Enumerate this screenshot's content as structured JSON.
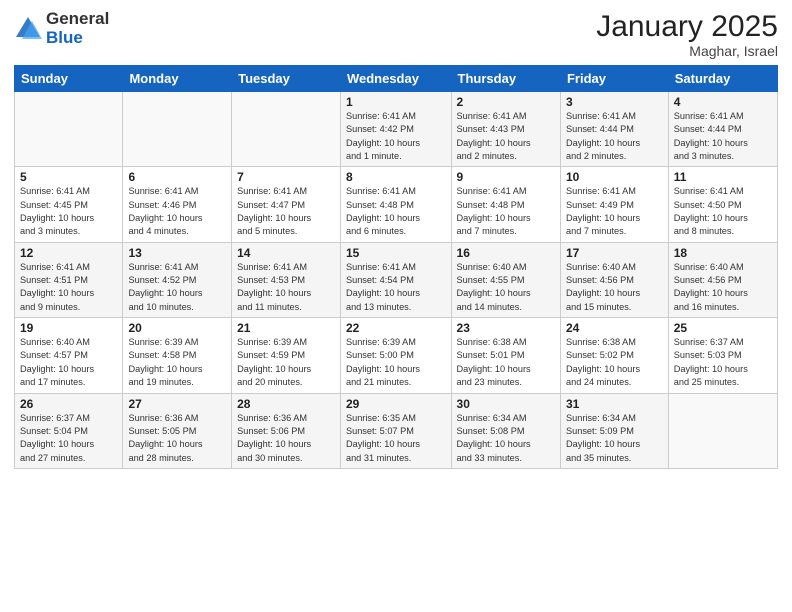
{
  "logo": {
    "general": "General",
    "blue": "Blue"
  },
  "header": {
    "title": "January 2025",
    "subtitle": "Maghar, Israel"
  },
  "weekdays": [
    "Sunday",
    "Monday",
    "Tuesday",
    "Wednesday",
    "Thursday",
    "Friday",
    "Saturday"
  ],
  "weeks": [
    [
      {
        "day": "",
        "info": ""
      },
      {
        "day": "",
        "info": ""
      },
      {
        "day": "",
        "info": ""
      },
      {
        "day": "1",
        "info": "Sunrise: 6:41 AM\nSunset: 4:42 PM\nDaylight: 10 hours\nand 1 minute."
      },
      {
        "day": "2",
        "info": "Sunrise: 6:41 AM\nSunset: 4:43 PM\nDaylight: 10 hours\nand 2 minutes."
      },
      {
        "day": "3",
        "info": "Sunrise: 6:41 AM\nSunset: 4:44 PM\nDaylight: 10 hours\nand 2 minutes."
      },
      {
        "day": "4",
        "info": "Sunrise: 6:41 AM\nSunset: 4:44 PM\nDaylight: 10 hours\nand 3 minutes."
      }
    ],
    [
      {
        "day": "5",
        "info": "Sunrise: 6:41 AM\nSunset: 4:45 PM\nDaylight: 10 hours\nand 3 minutes."
      },
      {
        "day": "6",
        "info": "Sunrise: 6:41 AM\nSunset: 4:46 PM\nDaylight: 10 hours\nand 4 minutes."
      },
      {
        "day": "7",
        "info": "Sunrise: 6:41 AM\nSunset: 4:47 PM\nDaylight: 10 hours\nand 5 minutes."
      },
      {
        "day": "8",
        "info": "Sunrise: 6:41 AM\nSunset: 4:48 PM\nDaylight: 10 hours\nand 6 minutes."
      },
      {
        "day": "9",
        "info": "Sunrise: 6:41 AM\nSunset: 4:48 PM\nDaylight: 10 hours\nand 7 minutes."
      },
      {
        "day": "10",
        "info": "Sunrise: 6:41 AM\nSunset: 4:49 PM\nDaylight: 10 hours\nand 7 minutes."
      },
      {
        "day": "11",
        "info": "Sunrise: 6:41 AM\nSunset: 4:50 PM\nDaylight: 10 hours\nand 8 minutes."
      }
    ],
    [
      {
        "day": "12",
        "info": "Sunrise: 6:41 AM\nSunset: 4:51 PM\nDaylight: 10 hours\nand 9 minutes."
      },
      {
        "day": "13",
        "info": "Sunrise: 6:41 AM\nSunset: 4:52 PM\nDaylight: 10 hours\nand 10 minutes."
      },
      {
        "day": "14",
        "info": "Sunrise: 6:41 AM\nSunset: 4:53 PM\nDaylight: 10 hours\nand 11 minutes."
      },
      {
        "day": "15",
        "info": "Sunrise: 6:41 AM\nSunset: 4:54 PM\nDaylight: 10 hours\nand 13 minutes."
      },
      {
        "day": "16",
        "info": "Sunrise: 6:40 AM\nSunset: 4:55 PM\nDaylight: 10 hours\nand 14 minutes."
      },
      {
        "day": "17",
        "info": "Sunrise: 6:40 AM\nSunset: 4:56 PM\nDaylight: 10 hours\nand 15 minutes."
      },
      {
        "day": "18",
        "info": "Sunrise: 6:40 AM\nSunset: 4:56 PM\nDaylight: 10 hours\nand 16 minutes."
      }
    ],
    [
      {
        "day": "19",
        "info": "Sunrise: 6:40 AM\nSunset: 4:57 PM\nDaylight: 10 hours\nand 17 minutes."
      },
      {
        "day": "20",
        "info": "Sunrise: 6:39 AM\nSunset: 4:58 PM\nDaylight: 10 hours\nand 19 minutes."
      },
      {
        "day": "21",
        "info": "Sunrise: 6:39 AM\nSunset: 4:59 PM\nDaylight: 10 hours\nand 20 minutes."
      },
      {
        "day": "22",
        "info": "Sunrise: 6:39 AM\nSunset: 5:00 PM\nDaylight: 10 hours\nand 21 minutes."
      },
      {
        "day": "23",
        "info": "Sunrise: 6:38 AM\nSunset: 5:01 PM\nDaylight: 10 hours\nand 23 minutes."
      },
      {
        "day": "24",
        "info": "Sunrise: 6:38 AM\nSunset: 5:02 PM\nDaylight: 10 hours\nand 24 minutes."
      },
      {
        "day": "25",
        "info": "Sunrise: 6:37 AM\nSunset: 5:03 PM\nDaylight: 10 hours\nand 25 minutes."
      }
    ],
    [
      {
        "day": "26",
        "info": "Sunrise: 6:37 AM\nSunset: 5:04 PM\nDaylight: 10 hours\nand 27 minutes."
      },
      {
        "day": "27",
        "info": "Sunrise: 6:36 AM\nSunset: 5:05 PM\nDaylight: 10 hours\nand 28 minutes."
      },
      {
        "day": "28",
        "info": "Sunrise: 6:36 AM\nSunset: 5:06 PM\nDaylight: 10 hours\nand 30 minutes."
      },
      {
        "day": "29",
        "info": "Sunrise: 6:35 AM\nSunset: 5:07 PM\nDaylight: 10 hours\nand 31 minutes."
      },
      {
        "day": "30",
        "info": "Sunrise: 6:34 AM\nSunset: 5:08 PM\nDaylight: 10 hours\nand 33 minutes."
      },
      {
        "day": "31",
        "info": "Sunrise: 6:34 AM\nSunset: 5:09 PM\nDaylight: 10 hours\nand 35 minutes."
      },
      {
        "day": "",
        "info": ""
      }
    ]
  ]
}
